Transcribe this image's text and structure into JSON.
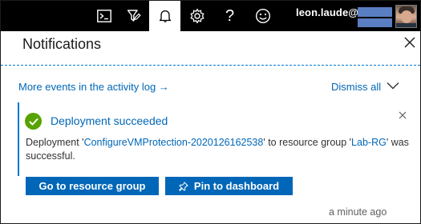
{
  "topbar": {
    "icons": [
      "cloud-shell-icon",
      "directory-filter-icon",
      "notifications-icon",
      "settings-icon",
      "help-icon",
      "feedback-icon"
    ],
    "help_glyph": "?",
    "user_label": "leon.laude@",
    "redact_color": "#5a7ec2",
    "active_color": "#ffffff"
  },
  "panel": {
    "title": "Notifications",
    "events_link": "More events in the activity log",
    "events_arrow": "→",
    "dismiss_all": "Dismiss all"
  },
  "notification": {
    "status_color": "#57a300",
    "title": "Deployment succeeded",
    "msg_prefix": "Deployment '",
    "deployment_name": "ConfigureVMProtection-2020126162538",
    "msg_middle": "' to resource group '",
    "resource_group": "Lab-RG",
    "msg_suffix": "' was successful.",
    "btn_goto": "Go to resource group",
    "btn_pin": "Pin to dashboard",
    "timestamp": "a minute ago"
  },
  "colors": {
    "accent": "#0078d4",
    "link": "#0067b8",
    "button_bg": "#0067b8"
  }
}
